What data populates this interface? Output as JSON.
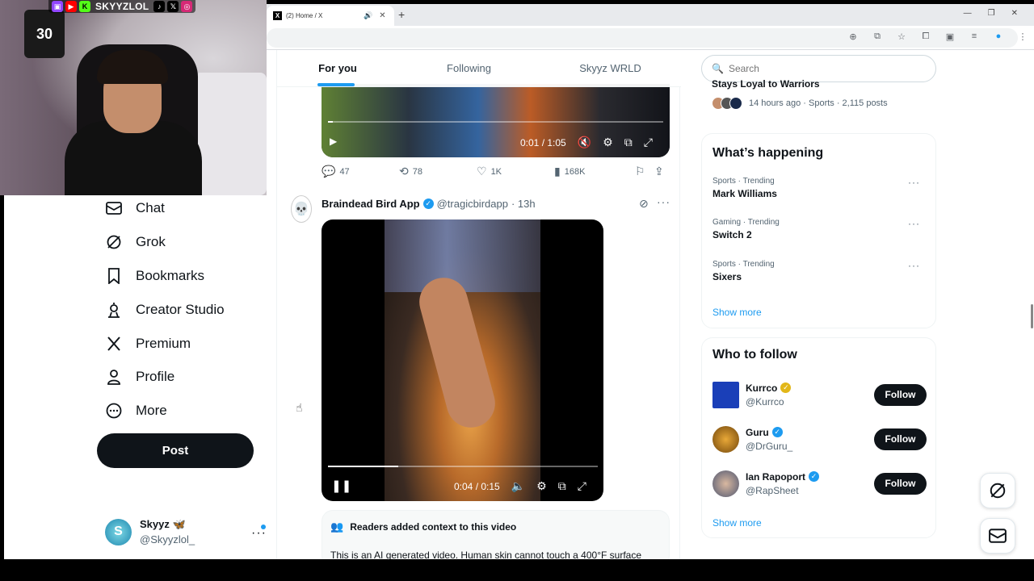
{
  "overlay": {
    "handle": "SKYYZLOL",
    "social_icons": [
      "twitch-icon",
      "youtube-icon",
      "kick-icon",
      "tiktok-icon",
      "x-icon",
      "instagram-icon"
    ]
  },
  "browser": {
    "tab_title": "(2) Home / X"
  },
  "nav": {
    "items": [
      {
        "label": "Chat",
        "icon": "envelope-icon"
      },
      {
        "label": "Grok",
        "icon": "grok-icon"
      },
      {
        "label": "Bookmarks",
        "icon": "bookmark-icon"
      },
      {
        "label": "Creator Studio",
        "icon": "creator-studio-icon"
      },
      {
        "label": "Premium",
        "icon": "x-logo-icon"
      },
      {
        "label": "Profile",
        "icon": "person-icon"
      },
      {
        "label": "More",
        "icon": "more-circle-icon"
      }
    ],
    "post_label": "Post",
    "account": {
      "name": "Skyyz 🦋",
      "handle": "@Skyyzlol_"
    }
  },
  "feed": {
    "tabs": [
      "For you",
      "Following",
      "Skyyz WRLD"
    ],
    "video1": {
      "time": "0:01 / 1:05",
      "progress": 0.015
    },
    "actions": {
      "replies": "47",
      "reposts": "78",
      "likes": "1K",
      "views": "168K"
    },
    "tweet2": {
      "name": "Braindead Bird App",
      "handle": "@tragicbirdapp",
      "time": "· 13h",
      "video_time": "0:04 / 0:15",
      "video_progress": 0.26
    },
    "context": {
      "header": "Readers added context to this video",
      "text": "This is an AI generated video. Human skin cannot touch a 400°F surface"
    }
  },
  "sidebar": {
    "search_placeholder": "Search",
    "top_trend": {
      "title": "Stays Loyal to Warriors",
      "meta": "14 hours ago · Sports · 2,115 posts"
    },
    "happening": {
      "title": "What’s happening",
      "trends": [
        {
          "meta": "Sports · Trending",
          "title": "Mark Williams"
        },
        {
          "meta": "Gaming · Trending",
          "title": "Switch 2"
        },
        {
          "meta": "Sports · Trending",
          "title": "Sixers"
        }
      ],
      "show_more": "Show more"
    },
    "who_to_follow": {
      "title": "Who to follow",
      "accounts": [
        {
          "name": "Kurrco",
          "handle": "@Kurrco",
          "badge": "gold"
        },
        {
          "name": "Guru",
          "handle": "@DrGuru_",
          "badge": "blue"
        },
        {
          "name": "Ian Rapoport",
          "handle": "@RapSheet",
          "badge": "blue"
        }
      ],
      "follow_label": "Follow",
      "show_more": "Show more"
    }
  },
  "colors": {
    "accent": "#1d9bf0",
    "text": "#0f1419",
    "muted": "#536471",
    "gold": "#e2b719"
  }
}
